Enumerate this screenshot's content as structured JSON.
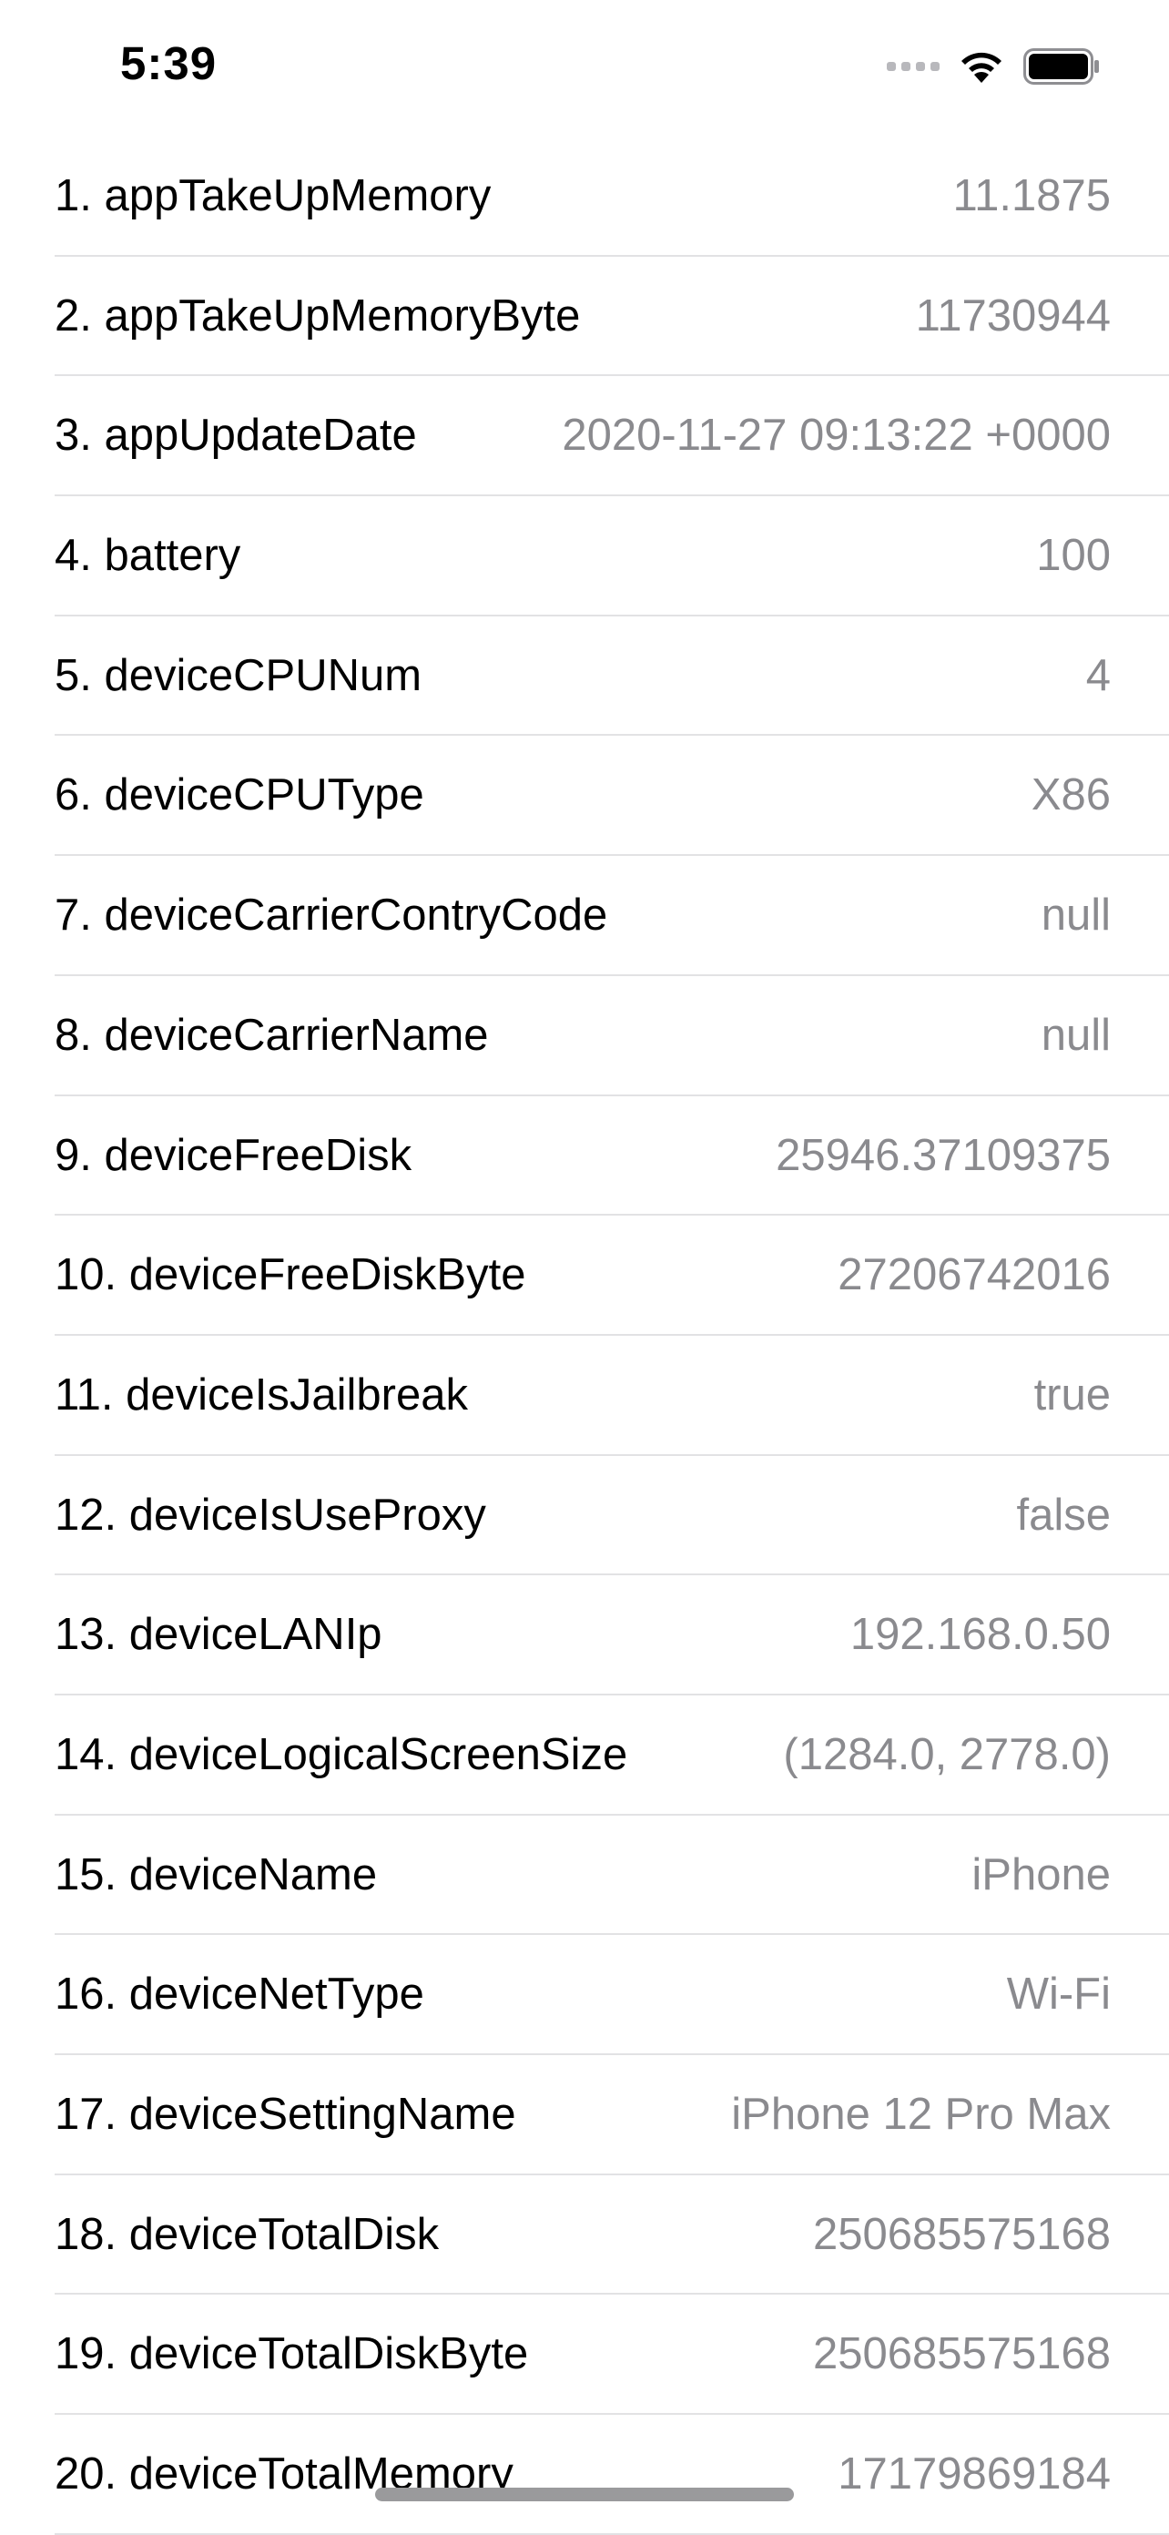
{
  "status_bar": {
    "time": "5:39",
    "icons": [
      "cellular-signal-icon",
      "wifi-icon",
      "battery-icon"
    ]
  },
  "rows": [
    {
      "label": "1. appTakeUpMemory",
      "value": "11.1875"
    },
    {
      "label": "2. appTakeUpMemoryByte",
      "value": "11730944"
    },
    {
      "label": "3. appUpdateDate",
      "value": "2020-11-27 09:13:22 +0000"
    },
    {
      "label": "4. battery",
      "value": "100"
    },
    {
      "label": "5. deviceCPUNum",
      "value": "4"
    },
    {
      "label": "6. deviceCPUType",
      "value": "X86"
    },
    {
      "label": "7. deviceCarrierContryCode",
      "value": "null"
    },
    {
      "label": "8. deviceCarrierName",
      "value": "null"
    },
    {
      "label": "9. deviceFreeDisk",
      "value": "25946.37109375"
    },
    {
      "label": "10. deviceFreeDiskByte",
      "value": "27206742016"
    },
    {
      "label": "11. deviceIsJailbreak",
      "value": "true"
    },
    {
      "label": "12. deviceIsUseProxy",
      "value": "false"
    },
    {
      "label": "13. deviceLANIp",
      "value": "192.168.0.50"
    },
    {
      "label": "14. deviceLogicalScreenSize",
      "value": "(1284.0, 2778.0)"
    },
    {
      "label": "15. deviceName",
      "value": "iPhone"
    },
    {
      "label": "16. deviceNetType",
      "value": "Wi-Fi"
    },
    {
      "label": "17. deviceSettingName",
      "value": "iPhone 12 Pro Max"
    },
    {
      "label": "18. deviceTotalDisk",
      "value": "250685575168"
    },
    {
      "label": "19. deviceTotalDiskByte",
      "value": "250685575168"
    },
    {
      "label": "20. deviceTotalMemory",
      "value": "17179869184"
    }
  ]
}
